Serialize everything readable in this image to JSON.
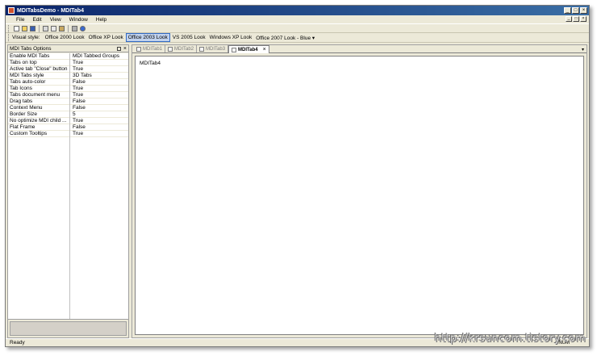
{
  "window": {
    "title": "MDITabsDemo - MDITab4",
    "caption_buttons": [
      "_",
      "□",
      "×"
    ]
  },
  "menu": {
    "items": [
      "File",
      "Edit",
      "View",
      "Window",
      "Help"
    ],
    "mdi_buttons": [
      "_",
      "□",
      "×"
    ]
  },
  "toolbar": {
    "icons": [
      "new-icon",
      "open-icon",
      "save-icon",
      "cut-icon",
      "copy-icon",
      "paste-icon",
      "print-icon",
      "help-icon"
    ]
  },
  "stylebar": {
    "label": "Visual style:",
    "styles": [
      "Office 2000 Look",
      "Office XP Look",
      "Office 2003 Look",
      "VS 2005 Look",
      "Windows XP Look",
      "Office 2007 Look - Blue ▾"
    ],
    "selected": "Office 2003 Look"
  },
  "options_panel": {
    "title": "MDI Tabs Options",
    "pin_glyph": "▣",
    "close_glyph": "×",
    "rows": [
      {
        "key": "Enable MDI Tabs",
        "value": "MDI Tabbed Groups"
      },
      {
        "key": "Tabs on top",
        "value": "True"
      },
      {
        "key": "Active tab \"Close\" button",
        "value": "True"
      },
      {
        "key": "MDI Tabs style",
        "value": "3D Tabs"
      },
      {
        "key": "Tabs auto-color",
        "value": "False"
      },
      {
        "key": "Tab Icons",
        "value": "True"
      },
      {
        "key": "Tabs document menu",
        "value": "True"
      },
      {
        "key": "Drag tabs",
        "value": "False"
      },
      {
        "key": "Context Menu",
        "value": "False"
      },
      {
        "key": "Border Size",
        "value": "5"
      },
      {
        "key": "No optimize MDI child ...",
        "value": "True"
      },
      {
        "key": "Flat Frame",
        "value": "False"
      },
      {
        "key": "Custom Tooltips",
        "value": "True"
      }
    ]
  },
  "tabs": [
    {
      "label": "MDITab1",
      "active": false
    },
    {
      "label": "MDITab2",
      "active": false
    },
    {
      "label": "MDITab3",
      "active": false
    },
    {
      "label": "MDITab4",
      "active": true
    }
  ],
  "tab_close_glyph": "×",
  "tab_menu_glyph": "▾",
  "document": {
    "text": "MDITab4"
  },
  "status": {
    "text": "Ready",
    "indicator": "NUM"
  },
  "watermark": "http://krsuncom.tistory.com"
}
